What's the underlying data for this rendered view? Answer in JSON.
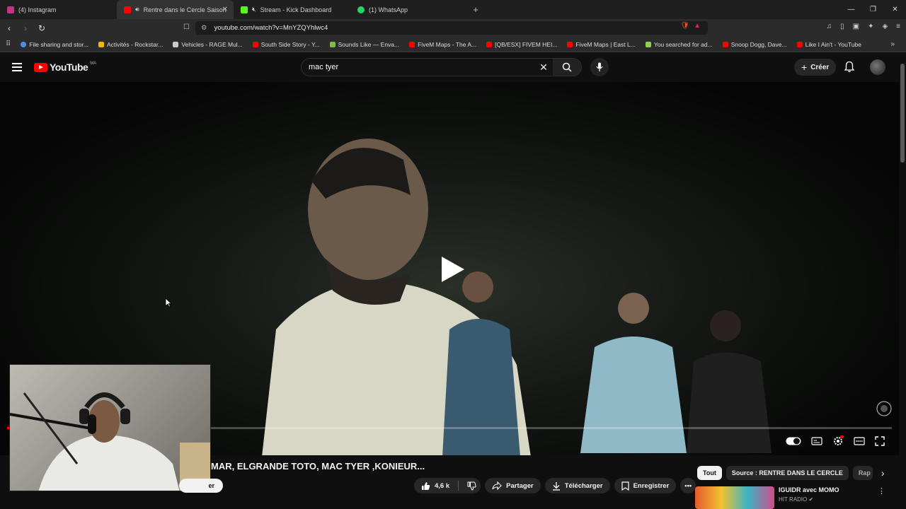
{
  "tabs": [
    {
      "label": "(4) Instagram",
      "color": "#c13584"
    },
    {
      "label": "Rentre dans le Cercle Saison",
      "color": "#ff0000",
      "active": true
    },
    {
      "label": "Stream - Kick Dashboard",
      "color": "#53fc18"
    },
    {
      "label": "(1) WhatsApp",
      "color": "#25d366"
    }
  ],
  "address": {
    "url": "youtube.com/watch?v=MnYZQYhlwc4"
  },
  "bookmarks": [
    {
      "label": "File sharing and stor...",
      "color": "#4a90e2"
    },
    {
      "label": "Activités - Rockstar...",
      "color": "#f5b800"
    },
    {
      "label": "Vehicles - RAGE Mul...",
      "color": "#cccccc"
    },
    {
      "label": "South Side Story - Y...",
      "color": "#ff0000"
    },
    {
      "label": "Sounds Like — Enva...",
      "color": "#81b94b"
    },
    {
      "label": "FiveM Maps - The A...",
      "color": "#ff0000"
    },
    {
      "label": "[QB/ESX] FIVEM HEI...",
      "color": "#ff0000"
    },
    {
      "label": "FiveM Maps | East L...",
      "color": "#ff0000"
    },
    {
      "label": "You searched for ad...",
      "color": "#8fd14f"
    },
    {
      "label": "Snoop Dogg, Dave...",
      "color": "#ff0000"
    },
    {
      "label": "Like I Ain't - YouTube",
      "color": "#ff0000"
    }
  ],
  "youtube": {
    "logo": "YouTube",
    "region": "MA",
    "search_query": "mac tyer",
    "create_label": "Créer"
  },
  "video": {
    "title": "MAR, ELGRANDE TOTO, MAC TYER ,KONIEUR...",
    "subscribe_fragment": "er",
    "likes": "4,6 k",
    "share_label": "Partager",
    "download_label": "Télécharger",
    "save_label": "Enregistrer"
  },
  "chips": [
    "Tout",
    "Source : RENTRE DANS LE CERCLE",
    "Rap"
  ],
  "recommendation": {
    "title": "IGUIDR avec MOMO",
    "channel": "HIT RADIO"
  },
  "window_controls": [
    "—",
    "❐",
    "✕"
  ]
}
